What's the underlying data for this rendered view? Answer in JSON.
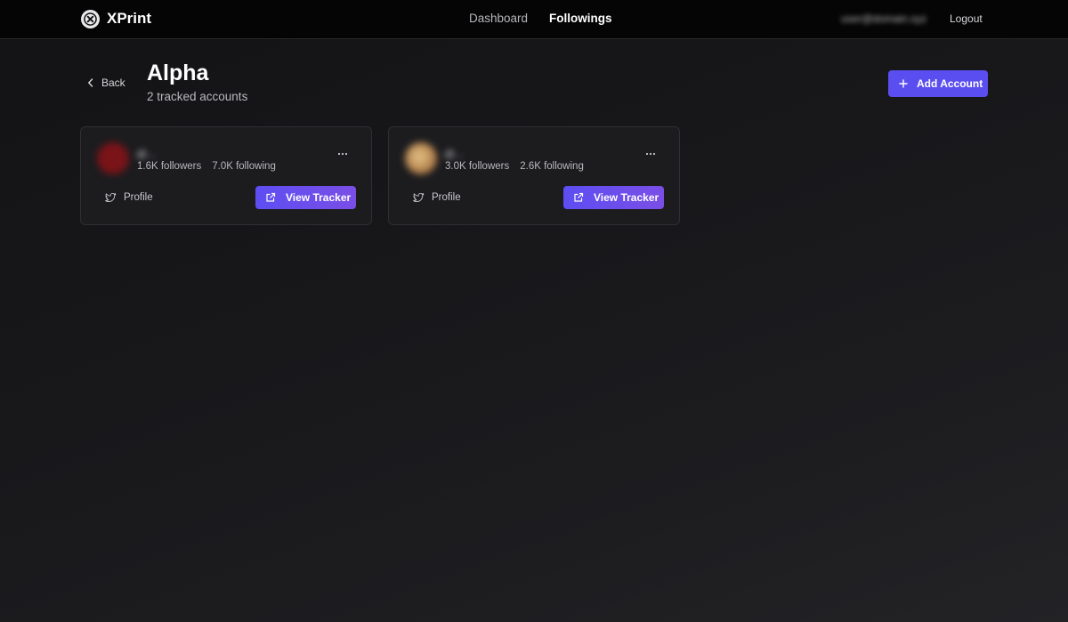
{
  "app": {
    "name": "XPrint"
  },
  "nav": {
    "dashboard": "Dashboard",
    "followings": "Followings"
  },
  "user": {
    "email": "user@domain.xyz",
    "logout": "Logout"
  },
  "header": {
    "back": "Back",
    "title": "Alpha",
    "subtitle": "2 tracked accounts",
    "add_account": "Add Account"
  },
  "accounts": [
    {
      "handle": "@...",
      "followers": "1.6K followers",
      "following": "7.0K following",
      "profile_label": "Profile",
      "view_label": "View Tracker",
      "avatar_color": "#7a1418"
    },
    {
      "handle": "@...",
      "followers": "3.0K followers",
      "following": "2.6K following",
      "profile_label": "Profile",
      "view_label": "View Tracker",
      "avatar_color": "#c9a06a"
    }
  ],
  "colors": {
    "accent": "#5b4ef0",
    "topbar": "#050505",
    "card": "#1c1c1f"
  },
  "icons": [
    "x-logo-icon",
    "chevron-left-icon",
    "plus-icon",
    "ellipsis-icon",
    "twitter-icon",
    "external-link-icon"
  ]
}
